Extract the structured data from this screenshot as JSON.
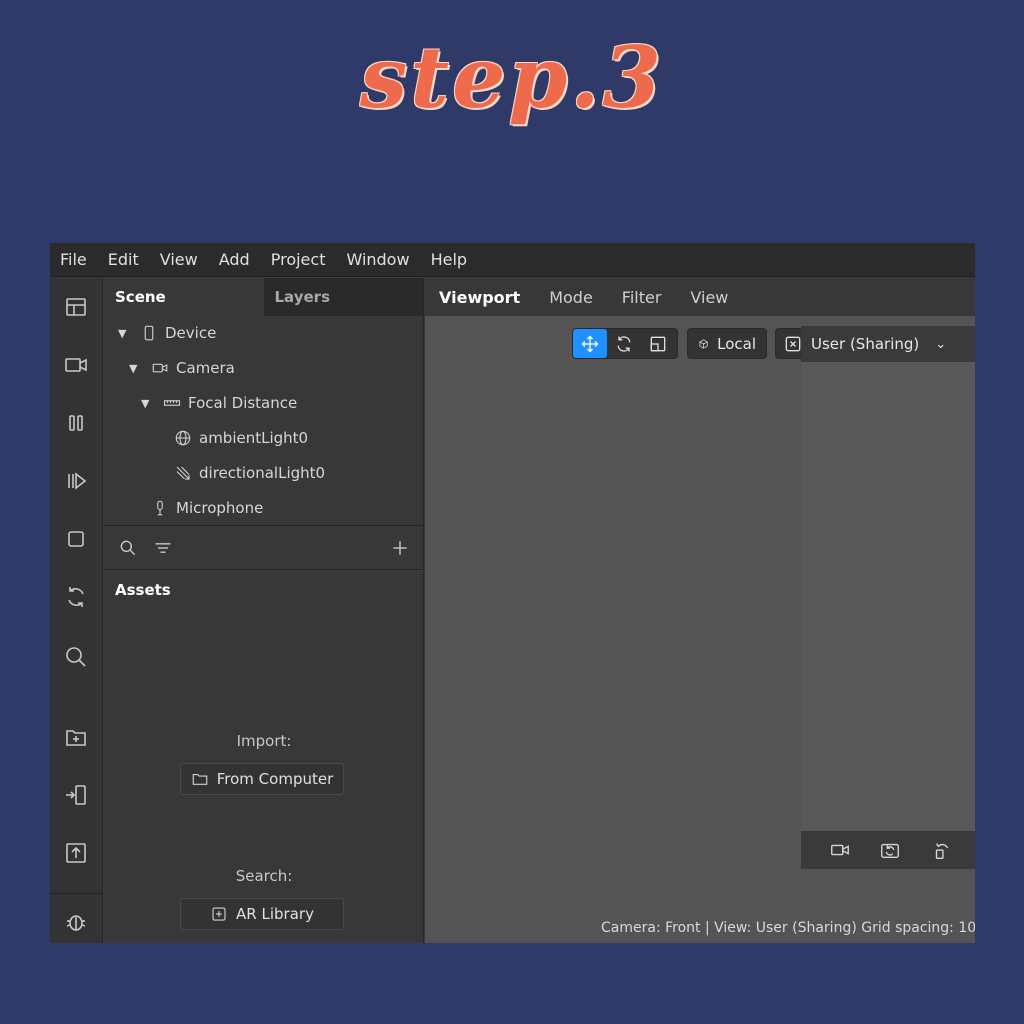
{
  "heading": "step.3",
  "menu": [
    "File",
    "Edit",
    "View",
    "Add",
    "Project",
    "Window",
    "Help"
  ],
  "toolstrip_icons": [
    "layout-icon",
    "video-camera-icon",
    "pause-icon",
    "step-play-icon",
    "stop-square-icon",
    "refresh-icon",
    "search-icon",
    "add-folder-icon",
    "send-to-device-icon",
    "upload-icon",
    "bug-icon"
  ],
  "scene_panel": {
    "tabs": [
      {
        "label": "Scene",
        "active": true
      },
      {
        "label": "Layers",
        "active": false
      }
    ],
    "tree": [
      {
        "label": "Device",
        "icon": "phone-icon",
        "expanded": true
      },
      {
        "label": "Camera",
        "icon": "camera-icon",
        "expanded": true
      },
      {
        "label": "Focal Distance",
        "icon": "ruler-icon",
        "expanded": true
      },
      {
        "label": "ambientLight0",
        "icon": "globe-icon"
      },
      {
        "label": "directionalLight0",
        "icon": "directional-light-icon"
      },
      {
        "label": "Microphone",
        "icon": "microphone-icon"
      }
    ]
  },
  "assets_panel": {
    "title": "Assets",
    "import_label": "Import:",
    "import_button": "From Computer",
    "search_label": "Search:",
    "search_button": "AR Library"
  },
  "viewport": {
    "tabs": [
      {
        "label": "Viewport",
        "active": true
      },
      {
        "label": "Mode"
      },
      {
        "label": "Filter"
      },
      {
        "label": "View"
      }
    ],
    "local_label": "Local",
    "user_view_label": "User (Sharing)",
    "status": "Camera: Front | View: User (Sharing)   Grid spacing: 10"
  },
  "colors": {
    "background": "#2f3a68",
    "heading": "#ee6a4c",
    "selected_tool": "#1e90ff"
  }
}
